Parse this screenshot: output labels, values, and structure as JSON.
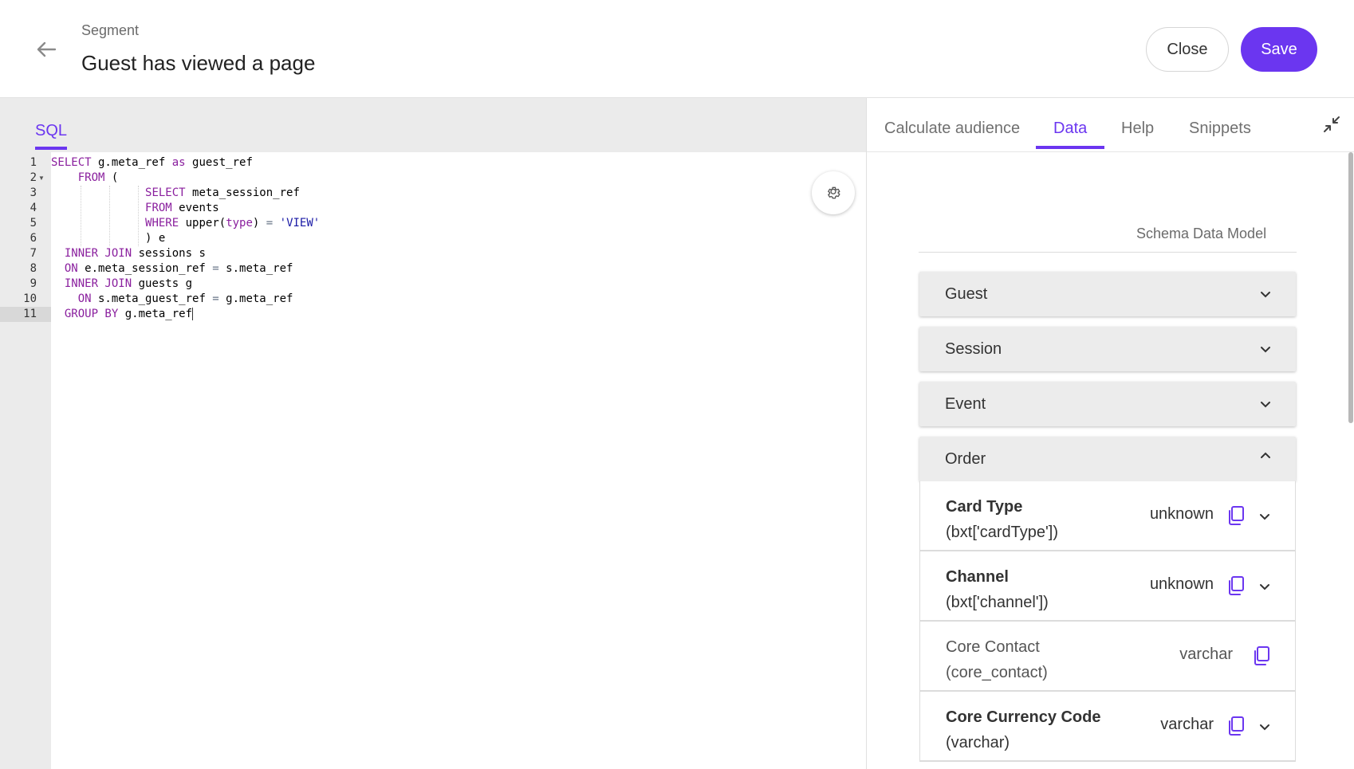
{
  "header": {
    "breadcrumb": "Segment",
    "title": "Guest has viewed a page",
    "close_label": "Close",
    "save_label": "Save"
  },
  "editor": {
    "tab_label": "SQL",
    "line_numbers": [
      "1",
      "2",
      "3",
      "4",
      "5",
      "6",
      "7",
      "8",
      "9",
      "10",
      "11"
    ]
  },
  "right_panel": {
    "tabs": [
      "Calculate audience",
      "Data",
      "Help",
      "Snippets"
    ],
    "active_tab": "Data",
    "schema_title": "Schema Data Model",
    "sections": [
      "Guest",
      "Session",
      "Event",
      "Order"
    ],
    "order_fields": [
      {
        "label": "Card Type",
        "key": "(bxt['cardType'])",
        "type": "unknown",
        "bold": true,
        "expandable": true
      },
      {
        "label": "Channel",
        "key": "(bxt['channel'])",
        "type": "unknown",
        "bold": true,
        "expandable": true
      },
      {
        "label": "Core Contact",
        "key": "(core_contact)",
        "type": "varchar",
        "bold": false,
        "expandable": false
      },
      {
        "label": "Core Currency Code",
        "key": "(varchar)",
        "type": "varchar",
        "bold": true,
        "expandable": true
      }
    ]
  },
  "colors": {
    "accent": "#6b36f0",
    "keyword": "#8a1f9e",
    "string": "#1a1aa6"
  }
}
